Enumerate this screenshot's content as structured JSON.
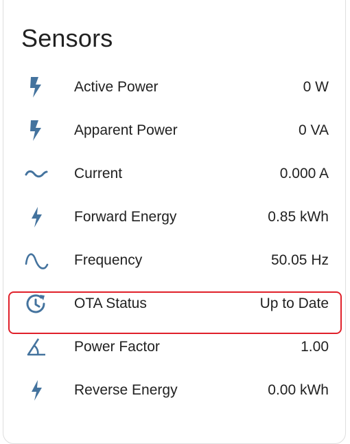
{
  "card": {
    "title": "Sensors"
  },
  "sensors": [
    {
      "label": "Active Power",
      "value": "0 W",
      "icon": "flash-icon"
    },
    {
      "label": "Apparent Power",
      "value": "0 VA",
      "icon": "flash-icon"
    },
    {
      "label": "Current",
      "value": "0.000 A",
      "icon": "current-ac-icon"
    },
    {
      "label": "Forward Energy",
      "value": "0.85 kWh",
      "icon": "lightning-bolt-icon"
    },
    {
      "label": "Frequency",
      "value": "50.05 Hz",
      "icon": "sine-wave-icon"
    },
    {
      "label": "OTA Status",
      "value": "Up to Date",
      "icon": "clock-update-icon"
    },
    {
      "label": "Power Factor",
      "value": "1.00",
      "icon": "angle-acute-icon"
    },
    {
      "label": "Reverse Energy",
      "value": "0.00 kWh",
      "icon": "lightning-bolt-icon"
    }
  ],
  "colors": {
    "icon": "#44739e",
    "text": "#212121",
    "highlight": "#e0202a"
  }
}
